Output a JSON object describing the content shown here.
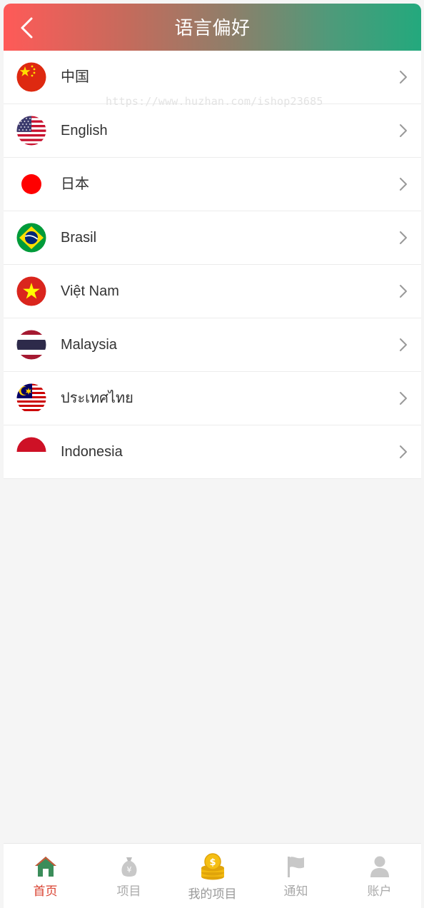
{
  "header": {
    "title": "语言偏好"
  },
  "watermark": "https://www.huzhan.com/ishop23685",
  "languages": [
    {
      "label": "中国",
      "flag": "china-flag-icon"
    },
    {
      "label": "English",
      "flag": "usa-flag-icon"
    },
    {
      "label": "日本",
      "flag": "japan-flag-icon"
    },
    {
      "label": "Brasil",
      "flag": "brazil-flag-icon"
    },
    {
      "label": "Việt Nam",
      "flag": "vietnam-flag-icon"
    },
    {
      "label": "Malaysia",
      "flag": "thailand-flag-icon"
    },
    {
      "label": "ประเทศไทย",
      "flag": "malaysia-flag-icon"
    },
    {
      "label": "Indonesia",
      "flag": "indonesia-flag-icon"
    }
  ],
  "tabbar": {
    "items": [
      {
        "label": "首页",
        "icon": "home-icon",
        "active": true
      },
      {
        "label": "项目",
        "icon": "money-bag-icon",
        "active": false
      },
      {
        "label": "我的项目",
        "icon": "coin-stack-icon",
        "active": false
      },
      {
        "label": "通知",
        "icon": "flag-icon",
        "active": false
      },
      {
        "label": "账户",
        "icon": "user-icon",
        "active": false
      }
    ]
  },
  "colors": {
    "header_start": "#ff5a58",
    "header_end": "#23a97d",
    "active_tab": "#d9402f",
    "inactive_tab": "#aaaaaa"
  }
}
